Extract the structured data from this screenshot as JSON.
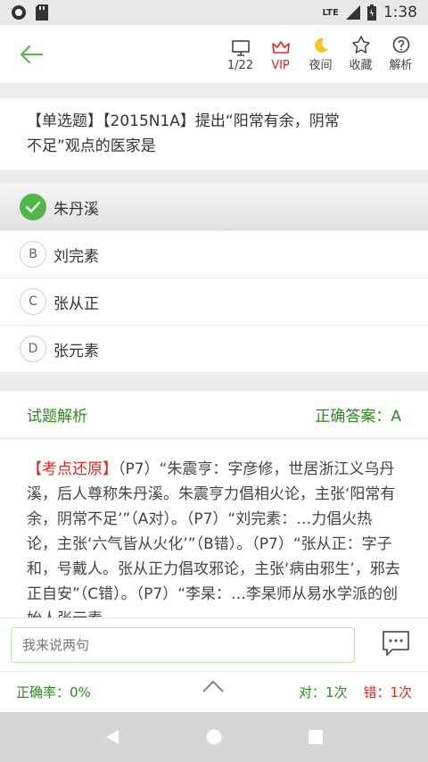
{
  "status": {
    "time": "1:38",
    "network": "LTE"
  },
  "toolbar": {
    "progress": "1/22",
    "vip": "VIP",
    "night": "夜间",
    "favorite": "收藏",
    "explain": "解析"
  },
  "question": {
    "line1": "【单选题】【2015N1A】提出“阳常有余，阴常",
    "line2": "不足”观点的医家是"
  },
  "options": [
    {
      "letter": "A",
      "text": "朱丹溪"
    },
    {
      "letter": "B",
      "text": "刘完素"
    },
    {
      "letter": "C",
      "text": "张从正"
    },
    {
      "letter": "D",
      "text": "张元素"
    }
  ],
  "analysis": {
    "title": "试题解析",
    "answer": "正确答案：A",
    "highlight": "【考点还原】",
    "body": "（P7）“朱震亨：字彦修，世居浙江义乌丹溪，后人尊称朱丹溪。朱震亨力倡相火论，主张‘阳常有余，阴常不足’”（A对）。（P7）“刘完素：…力倡火热论，主张‘六气皆从火化’”（B错）。（P7）“张从正：字子和，号戴人。张从正力倡攻邪论，主张‘病由邪生’，邪去正自安”（C错）。（P7）“李杲：…李杲师从易水学派的创始人张元素"
  },
  "comment": {
    "placeholder": "我来说两句"
  },
  "stats": {
    "rate": "正确率：0%",
    "correct": "对：1次",
    "wrong": "错：1次"
  }
}
